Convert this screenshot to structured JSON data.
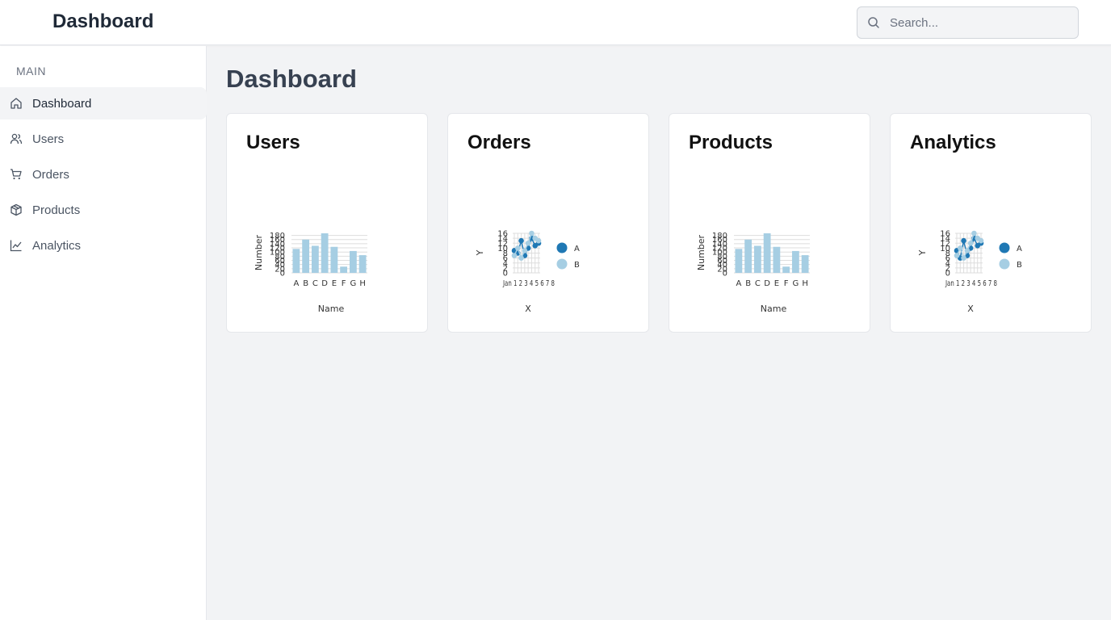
{
  "header": {
    "title": "Dashboard",
    "search_placeholder": "Search..."
  },
  "sidebar": {
    "section_label": "MAIN",
    "items": [
      {
        "label": "Dashboard",
        "icon": "home-icon",
        "active": true
      },
      {
        "label": "Users",
        "icon": "users-icon",
        "active": false
      },
      {
        "label": "Orders",
        "icon": "cart-icon",
        "active": false
      },
      {
        "label": "Products",
        "icon": "box-icon",
        "active": false
      },
      {
        "label": "Analytics",
        "icon": "chart-line-icon",
        "active": false
      }
    ]
  },
  "main": {
    "title": "Dashboard",
    "cards": [
      {
        "title": "Users"
      },
      {
        "title": "Orders"
      },
      {
        "title": "Products"
      },
      {
        "title": "Analytics"
      }
    ]
  },
  "colors": {
    "bar": "#a6cee3",
    "series_a": "#1f78b4",
    "series_b": "#a6cee3",
    "grid": "#dddddd"
  },
  "chart_data": [
    {
      "type": "bar",
      "card": "Users",
      "categories": [
        "A",
        "B",
        "C",
        "D",
        "E",
        "F",
        "G",
        "H"
      ],
      "values": [
        115,
        160,
        130,
        190,
        125,
        30,
        105,
        85
      ],
      "xlabel": "Name",
      "ylabel": "Number",
      "ylim": [
        0,
        190
      ],
      "yticks": [
        0,
        20,
        40,
        60,
        80,
        100,
        120,
        140,
        160,
        180
      ],
      "grid": true
    },
    {
      "type": "line",
      "card": "Orders",
      "xlabel": "X",
      "ylabel": "Y",
      "ylim": [
        0,
        16
      ],
      "yticks": [
        0,
        2,
        4,
        6,
        8,
        10,
        12,
        14,
        16
      ],
      "x": [
        "1",
        "2",
        "3",
        "4",
        "5",
        "6",
        "7",
        "8"
      ],
      "xtick_text": "Jan 1 2 3 4 5 6 7 8",
      "legend": "right",
      "series": [
        {
          "name": "A",
          "values": [
            9,
            8,
            13,
            7,
            10,
            14,
            11,
            12
          ]
        },
        {
          "name": "B",
          "values": [
            7,
            10,
            6,
            9,
            12,
            16,
            14,
            13
          ]
        }
      ]
    },
    {
      "type": "bar",
      "card": "Products",
      "categories": [
        "A",
        "B",
        "C",
        "D",
        "E",
        "F",
        "G",
        "H"
      ],
      "values": [
        115,
        160,
        130,
        190,
        125,
        30,
        105,
        85
      ],
      "xlabel": "Name",
      "ylabel": "Number",
      "ylim": [
        0,
        190
      ],
      "yticks": [
        0,
        20,
        40,
        60,
        80,
        100,
        120,
        140,
        160,
        180
      ],
      "grid": true
    },
    {
      "type": "line",
      "card": "Analytics",
      "xlabel": "X",
      "ylabel": "Y",
      "ylim": [
        0,
        16
      ],
      "yticks": [
        0,
        2,
        4,
        6,
        8,
        10,
        12,
        14,
        16
      ],
      "x": [
        "1",
        "2",
        "3",
        "4",
        "5",
        "6",
        "7",
        "8"
      ],
      "xtick_text": "Jan 1 2 3 4 5 6 7 8",
      "legend": "right",
      "series": [
        {
          "name": "A",
          "values": [
            9,
            6,
            13,
            7,
            10,
            14,
            11,
            12
          ]
        },
        {
          "name": "B",
          "values": [
            7,
            10,
            6,
            9,
            12,
            16,
            14,
            13
          ]
        }
      ]
    }
  ]
}
